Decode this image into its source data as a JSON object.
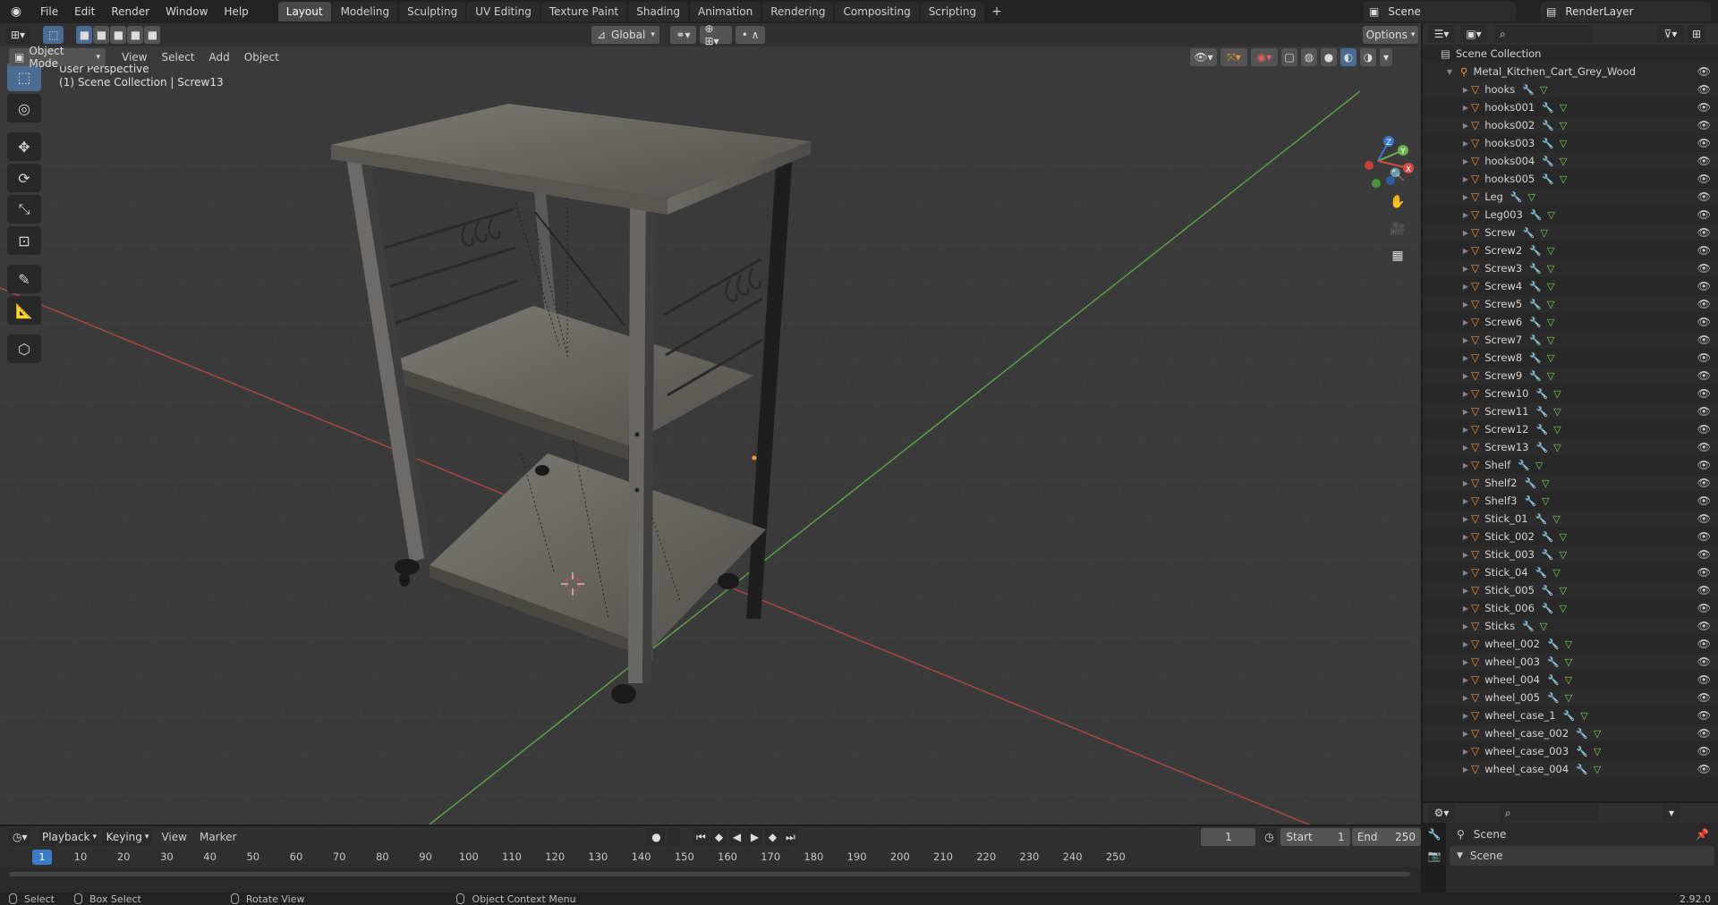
{
  "topbar": {
    "menus": [
      "File",
      "Edit",
      "Render",
      "Window",
      "Help"
    ],
    "workspaces": [
      "Layout",
      "Modeling",
      "Sculpting",
      "UV Editing",
      "Texture Paint",
      "Shading",
      "Animation",
      "Rendering",
      "Compositing",
      "Scripting"
    ],
    "active_workspace": "Layout",
    "add_icon": "+",
    "scene": "Scene",
    "view_layer": "RenderLayer"
  },
  "viewport": {
    "mode": "Object Mode",
    "menus": [
      "View",
      "Select",
      "Add",
      "Object"
    ],
    "orientation": "Global",
    "options": "Options",
    "info_line1": "User Perspective",
    "info_line2": "(1) Scene Collection | Screw13",
    "gizmo_axes": {
      "x": "X",
      "y": "Y",
      "z": "Z"
    }
  },
  "outliner": {
    "root": "Scene Collection",
    "collection": "Metal_Kitchen_Cart_Grey_Wood",
    "items": [
      "hooks",
      "hooks001",
      "hooks002",
      "hooks003",
      "hooks004",
      "hooks005",
      "Leg",
      "Leg003",
      "Screw",
      "Screw2",
      "Screw3",
      "Screw4",
      "Screw5",
      "Screw6",
      "Screw7",
      "Screw8",
      "Screw9",
      "Screw10",
      "Screw11",
      "Screw12",
      "Screw13",
      "Shelf",
      "Shelf2",
      "Shelf3",
      "Stick_01",
      "Stick_002",
      "Stick_003",
      "Stick_04",
      "Stick_005",
      "Stick_006",
      "Sticks",
      "wheel_002",
      "wheel_003",
      "wheel_004",
      "wheel_005",
      "wheel_case_1",
      "wheel_case_002",
      "wheel_case_003",
      "wheel_case_004"
    ]
  },
  "properties": {
    "scene_label": "Scene",
    "panel_label": "Scene"
  },
  "timeline": {
    "menus": [
      "Playback",
      "Keying",
      "View",
      "Marker"
    ],
    "current_frame": "1",
    "start_label": "Start",
    "start": "1",
    "end_label": "End",
    "end": "250",
    "ticks": [
      "10",
      "20",
      "30",
      "40",
      "50",
      "60",
      "70",
      "80",
      "90",
      "100",
      "110",
      "120",
      "130",
      "140",
      "150",
      "160",
      "170",
      "180",
      "190",
      "200",
      "210",
      "220",
      "230",
      "240",
      "250"
    ]
  },
  "status": {
    "select": "Select",
    "box_select": "Box Select",
    "rotate_view": "Rotate View",
    "context_menu": "Object Context Menu",
    "version": "2.92.0"
  },
  "colors": {
    "accent": "#4a6b92",
    "frame": "#3d7bc6",
    "object_icon": "#e8953a",
    "modifier_icon": "#6aa3e0",
    "mesh_icon": "#7fcf5a"
  }
}
